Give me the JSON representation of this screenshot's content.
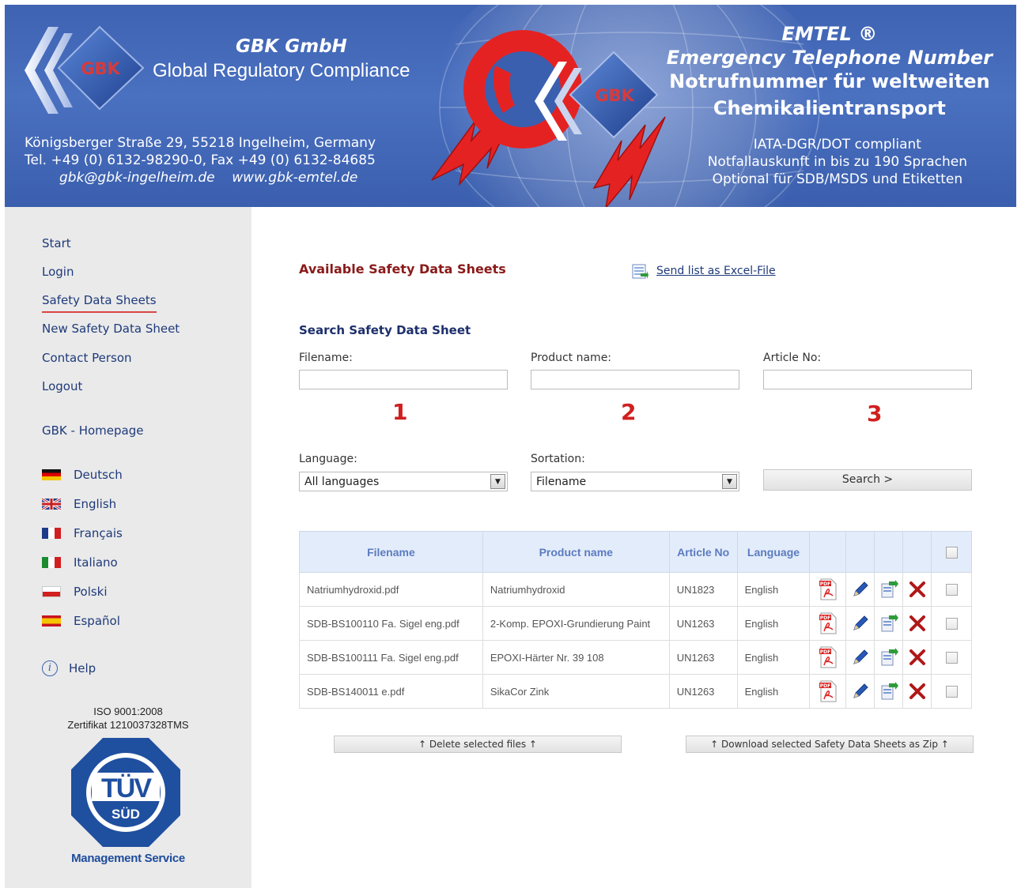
{
  "header": {
    "company": "GBK GmbH",
    "tagline": "Global Regulatory Compliance",
    "logo_text": "GBK",
    "address_line1": "Königsberger Straße 29, 55218 Ingelheim, Germany",
    "address_line2": "Tel. +49 (0) 6132-98290-0, Fax +49 (0) 6132-84685",
    "email": "gbk@gbk-ingelheim.de",
    "website": "www.gbk-emtel.de",
    "emtel_title": "EMTEL ®",
    "emtel_line2": "Emergency Telephone Number",
    "emtel_line3": "Notrufnummer für weltweiten",
    "emtel_line4": "Chemikalientransport",
    "iata_line1": "IATA-DGR/DOT compliant",
    "iata_line2": "Notfallauskunft in bis zu 190 Sprachen",
    "iata_line3": "Optional für SDB/MSDS und Etiketten",
    "center_logo_text": "GBK"
  },
  "sidebar": {
    "nav": [
      {
        "label": "Start"
      },
      {
        "label": "Login"
      },
      {
        "label": "Safety Data Sheets"
      },
      {
        "label": "New Safety Data Sheet"
      },
      {
        "label": "Contact Person"
      },
      {
        "label": "Logout"
      }
    ],
    "homepage": "GBK - Homepage",
    "languages": [
      {
        "label": "Deutsch",
        "icon": "flag-de-icon"
      },
      {
        "label": "English",
        "icon": "flag-uk-icon"
      },
      {
        "label": "Français",
        "icon": "flag-fr-icon"
      },
      {
        "label": "Italiano",
        "icon": "flag-it-icon"
      },
      {
        "label": "Polski",
        "icon": "flag-pl-icon"
      },
      {
        "label": "Español",
        "icon": "flag-es-icon"
      }
    ],
    "help": "Help",
    "iso_line1": "ISO 9001:2008",
    "iso_line2": "Zertifikat 1210037328TMS",
    "tuv_line1": "TÜV",
    "tuv_line2": "SÜD",
    "management": "Management Service"
  },
  "main": {
    "title": "Available Safety Data Sheets",
    "excel_link": "Send list as Excel-File",
    "search_title": "Search Safety Data Sheet",
    "filename_label": "Filename:",
    "product_label": "Product name:",
    "article_label": "Article No:",
    "marker1": "1",
    "marker2": "2",
    "marker3": "3",
    "language_label": "Language:",
    "language_value": "All languages",
    "sortation_label": "Sortation:",
    "sortation_value": "Filename",
    "search_button": "Search >",
    "table": {
      "headers": [
        "Filename",
        "Product name",
        "Article No",
        "Language"
      ],
      "rows": [
        {
          "filename": "Natriumhydroxid.pdf",
          "product": "Natriumhydroxid",
          "article": "UN1823",
          "language": "English"
        },
        {
          "filename": "SDB-BS100110 Fa. Sigel eng.pdf",
          "product": "2-Komp. EPOXI-Grundierung Paint",
          "article": "UN1263",
          "language": "English"
        },
        {
          "filename": "SDB-BS100111 Fa. Sigel eng.pdf",
          "product": "EPOXI-Härter Nr. 39 108",
          "article": "UN1263",
          "language": "English"
        },
        {
          "filename": "SDB-BS140011 e.pdf",
          "product": "SikaCor Zink",
          "article": "UN1263",
          "language": "English"
        }
      ]
    },
    "delete_button": "↑  Delete selected files  ↑",
    "download_button": "↑  Download selected Safety Data Sheets as Zip  ↑"
  },
  "colors": {
    "header_blue": "#4a70c0",
    "title_red": "#8b1a1a",
    "marker_red": "#d01f1f",
    "link_blue": "#1e3a7a",
    "table_header_bg": "#e3ecfa"
  }
}
